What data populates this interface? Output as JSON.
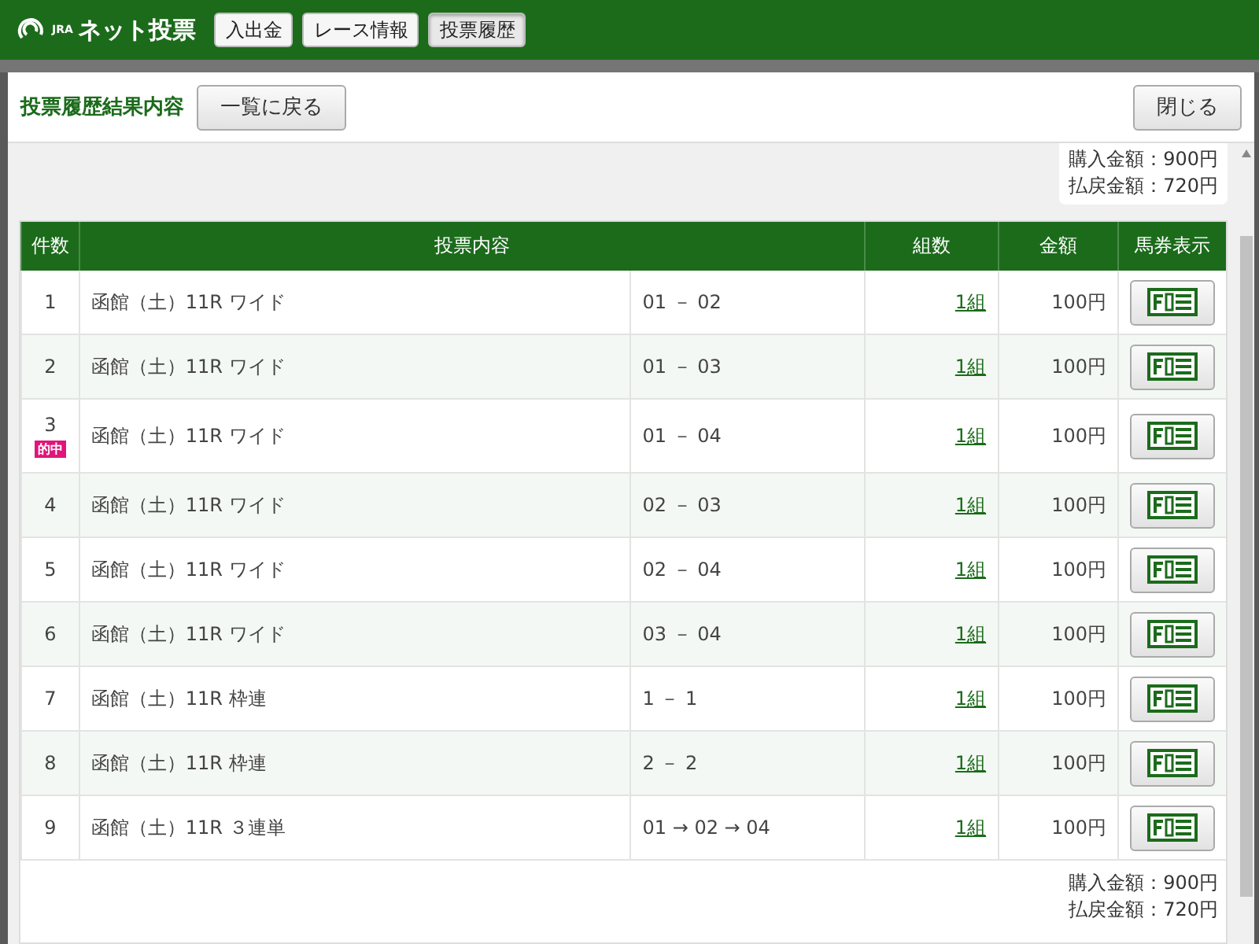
{
  "brand": {
    "mark": "JRA",
    "title": "ネット投票"
  },
  "nav": [
    {
      "label": "入出金",
      "selected": false
    },
    {
      "label": "レース情報",
      "selected": false
    },
    {
      "label": "投票履歴",
      "selected": true
    }
  ],
  "dialog": {
    "title": "投票履歴結果内容",
    "back_button": "一覧に戻る",
    "close_button": "閉じる"
  },
  "summary_top": [
    "購入金額：900円",
    "払戻金額：720円"
  ],
  "table": {
    "columns": [
      "件数",
      "投票内容",
      "組数",
      "金額",
      "馬券表示"
    ],
    "rows": [
      {
        "no": "1",
        "hit": false,
        "race": "函館（土）11R ワイド",
        "combo": "01 － 02",
        "sets": "1組",
        "amount": "100円"
      },
      {
        "no": "2",
        "hit": false,
        "race": "函館（土）11R ワイド",
        "combo": "01 － 03",
        "sets": "1組",
        "amount": "100円"
      },
      {
        "no": "3",
        "hit": true,
        "hit_label": "的中",
        "race": "函館（土）11R ワイド",
        "combo": "01 － 04",
        "sets": "1組",
        "amount": "100円"
      },
      {
        "no": "4",
        "hit": false,
        "race": "函館（土）11R ワイド",
        "combo": "02 － 03",
        "sets": "1組",
        "amount": "100円"
      },
      {
        "no": "5",
        "hit": false,
        "race": "函館（土）11R ワイド",
        "combo": "02 － 04",
        "sets": "1組",
        "amount": "100円"
      },
      {
        "no": "6",
        "hit": false,
        "race": "函館（土）11R ワイド",
        "combo": "03 － 04",
        "sets": "1組",
        "amount": "100円"
      },
      {
        "no": "7",
        "hit": false,
        "race": "函館（土）11R 枠連",
        "combo": "1 － 1",
        "sets": "1組",
        "amount": "100円"
      },
      {
        "no": "8",
        "hit": false,
        "race": "函館（土）11R 枠連",
        "combo": "2 － 2",
        "sets": "1組",
        "amount": "100円"
      },
      {
        "no": "9",
        "hit": false,
        "race": "函館（土）11R ３連単",
        "combo": "01 → 02 → 04",
        "sets": "1組",
        "amount": "100円"
      }
    ]
  },
  "summary_bottom": [
    "購入金額：900円",
    "払戻金額：720円"
  ]
}
